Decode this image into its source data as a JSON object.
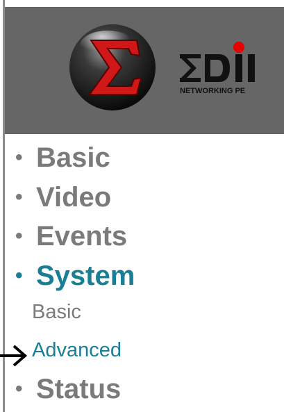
{
  "banner": {
    "brand_text": "ΣDI",
    "brand_tagline": "NETWORKING PE"
  },
  "nav": {
    "items": [
      {
        "label": "Basic",
        "bullet": "•",
        "active": false
      },
      {
        "label": "Video",
        "bullet": "•",
        "active": false
      },
      {
        "label": "Events",
        "bullet": "•",
        "active": false
      },
      {
        "label": "System",
        "bullet": "•",
        "active": true
      },
      {
        "label": "Status",
        "bullet": "•",
        "active": false
      }
    ],
    "system_submenu": [
      {
        "label": "Basic",
        "active": false
      },
      {
        "label": "Advanced",
        "active": true
      }
    ]
  },
  "colors": {
    "banner_bg": "#666666",
    "nav_text": "#7a7a7a",
    "nav_active": "#1a7f95",
    "logo_red": "#cc1111"
  },
  "icons": {
    "sigma_logo": "sigma-orb-logo",
    "pointer": "arrow-right-icon"
  }
}
